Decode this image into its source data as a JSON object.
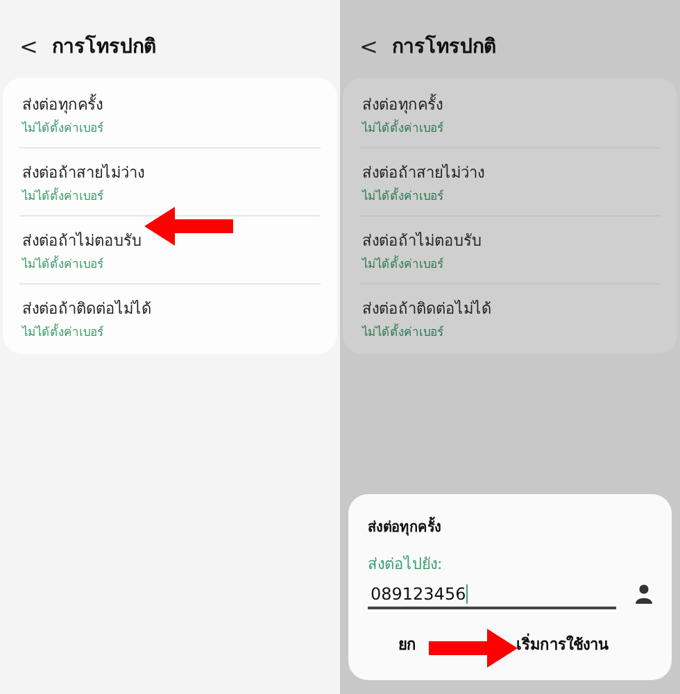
{
  "panels": [
    {
      "dimmed": false,
      "header": {
        "back": "<",
        "title": "การโทรปกติ"
      },
      "items": [
        {
          "title": "ส่งต่อทุกครั้ง",
          "subtitle": "ไม่ได้ตั้งค่าเบอร์"
        },
        {
          "title": "ส่งต่อถ้าสายไม่ว่าง",
          "subtitle": "ไม่ได้ตั้งค่าเบอร์"
        },
        {
          "title": "ส่งต่อถ้าไม่ตอบรับ",
          "subtitle": "ไม่ได้ตั้งค่าเบอร์"
        },
        {
          "title": "ส่งต่อถ้าติดต่อไม่ได้",
          "subtitle": "ไม่ได้ตั้งค่าเบอร์"
        }
      ],
      "annotation": {
        "kind": "left"
      }
    },
    {
      "dimmed": true,
      "header": {
        "back": "<",
        "title": "การโทรปกติ"
      },
      "items": [
        {
          "title": "ส่งต่อทุกครั้ง",
          "subtitle": "ไม่ได้ตั้งค่าเบอร์"
        },
        {
          "title": "ส่งต่อถ้าสายไม่ว่าง",
          "subtitle": "ไม่ได้ตั้งค่าเบอร์"
        },
        {
          "title": "ส่งต่อถ้าไม่ตอบรับ",
          "subtitle": "ไม่ได้ตั้งค่าเบอร์"
        },
        {
          "title": "ส่งต่อถ้าติดต่อไม่ได้",
          "subtitle": "ไม่ได้ตั้งค่าเบอร์"
        }
      ],
      "dialog": {
        "title": "ส่งต่อทุกครั้ง",
        "field_label": "ส่งต่อไปยัง:",
        "value": "089123456",
        "buttons": [
          "ยก",
          "เริ่มการใช้งาน"
        ]
      },
      "annotation": {
        "kind": "right"
      }
    }
  ]
}
